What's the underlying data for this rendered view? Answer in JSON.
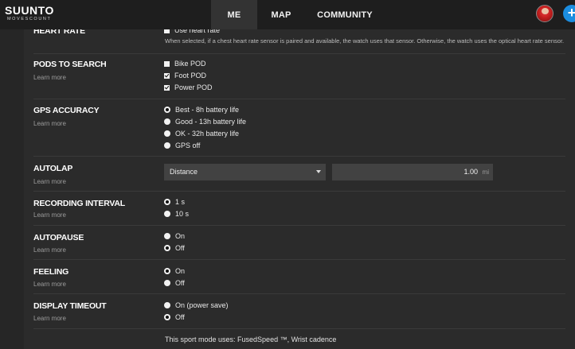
{
  "brand": {
    "name": "SUUNTO",
    "sub": "MOVESCOUNT"
  },
  "nav": {
    "me": "ME",
    "map": "MAP",
    "community": "COMMUNITY"
  },
  "common": {
    "learn_more": "Learn more"
  },
  "heart_rate": {
    "label": "HEART RATE",
    "option": "Use heart rate",
    "description": "When selected, if a chest heart rate sensor is paired and available, the watch uses that sensor. Otherwise, the watch uses the optical heart rate sensor."
  },
  "pods": {
    "label": "PODS TO SEARCH",
    "options": [
      {
        "label": "Bike POD",
        "checked": false
      },
      {
        "label": "Foot POD",
        "checked": true
      },
      {
        "label": "Power POD",
        "checked": true
      }
    ]
  },
  "gps": {
    "label": "GPS ACCURACY",
    "options": [
      {
        "label": "Best - 8h battery life",
        "checked": true
      },
      {
        "label": "Good - 13h battery life",
        "checked": false
      },
      {
        "label": "OK - 32h battery life",
        "checked": false
      },
      {
        "label": "GPS off",
        "checked": false
      }
    ]
  },
  "autolap": {
    "label": "AUTOLAP",
    "mode": "Distance",
    "value": "1.00",
    "unit": "mi"
  },
  "recording": {
    "label": "RECORDING INTERVAL",
    "options": [
      {
        "label": "1 s",
        "checked": true
      },
      {
        "label": "10 s",
        "checked": false
      }
    ]
  },
  "autopause": {
    "label": "AUTOPAUSE",
    "options": [
      {
        "label": "On",
        "checked": false
      },
      {
        "label": "Off",
        "checked": true
      }
    ]
  },
  "feeling": {
    "label": "FEELING",
    "options": [
      {
        "label": "On",
        "checked": true
      },
      {
        "label": "Off",
        "checked": false
      }
    ]
  },
  "display_timeout": {
    "label": "DISPLAY TIMEOUT",
    "options": [
      {
        "label": "On (power save)",
        "checked": false
      },
      {
        "label": "Off",
        "checked": true
      }
    ]
  },
  "footer": {
    "note": "This sport mode uses: FusedSpeed ™, Wrist cadence"
  }
}
